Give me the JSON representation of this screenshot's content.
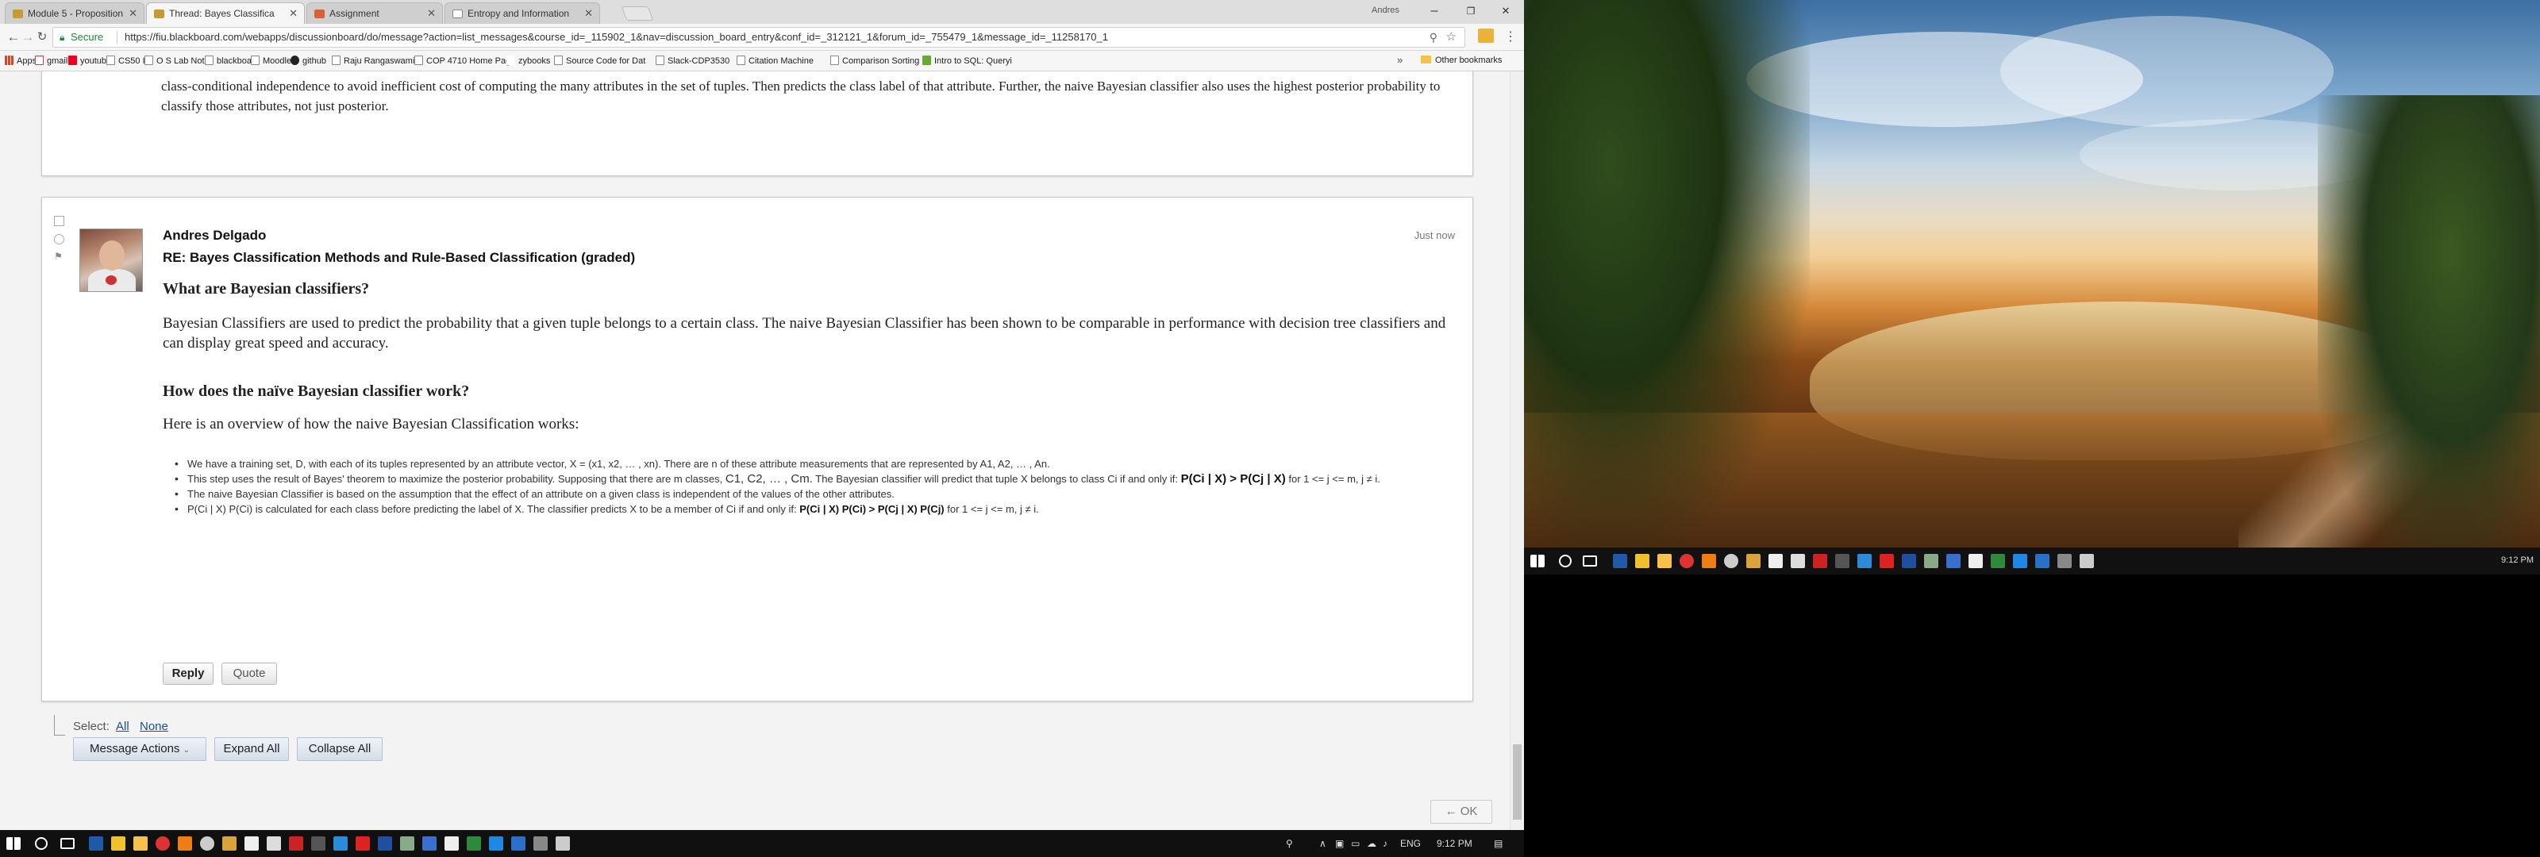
{
  "browser": {
    "profile_name": "Andres",
    "tabs": [
      {
        "label": "Module 5 - Proposition",
        "color": "#c69a3b",
        "active": false
      },
      {
        "label": "Thread: Bayes Classifica",
        "color": "#c69a3b",
        "active": true
      },
      {
        "label": "Assignment",
        "color": "#d9613a",
        "active": false
      },
      {
        "label": "Entropy and Information",
        "color": "#888888",
        "active": false
      }
    ],
    "window_controls": {
      "minimize": "–",
      "maximize": "❐",
      "close": "✕"
    },
    "secure_label": "Secure",
    "url": "https://fiu.blackboard.com/webapps/discussionboard/do/message?action=list_messages&course_id=_115902_1&nav=discussion_board_entry&conf_id=_312121_1&forum_id=_755479_1&message_id=_11258170_1",
    "bookmarks": [
      "Apps",
      "gmail",
      "youtube",
      "CS50 ID",
      "O S Lab Notes",
      "blackboard",
      "Moodle",
      "github",
      "Raju Rangaswami",
      "COP 4710 Home Pag",
      "zybooks",
      "Source Code for Dat",
      "Slack-CDP3530",
      "Citation Machine",
      "Comparison Sorting",
      "Intro to SQL: Queryi"
    ],
    "bookmarks_more": "»",
    "other_bookmarks": "Other bookmarks"
  },
  "previous_post": {
    "text": "class-conditional independence to avoid inefficient cost of computing the many attributes in the set of tuples. Then predicts the class label of that attribute. Further, the naive Bayesian classifier also uses the highest posterior probability to classify those attributes, not just posterior."
  },
  "post": {
    "author": "Andres Delgado",
    "timestamp": "Just now",
    "subject": "RE: Bayes Classification Methods and Rule-Based Classification (graded)",
    "heading1": "What are Bayesian classifiers?",
    "para1": "Bayesian Classifiers are used to predict the probability that a given tuple belongs to a certain class. The naive Bayesian Classifier has been shown to be comparable in performance with decision tree classifiers and can display great speed and accuracy.",
    "heading2": "How does the naïve Bayesian classifier work?",
    "para2": "Here is an overview of how the naive Bayesian Classification works:",
    "bullet1": "We have a training set, D, with each of its tuples represented by an attribute vector, X = (x1, x2, … , xn). There are n of these attribute measurements that are represented by A1, A2, … , An.",
    "bullet2a": "This step uses the result of Bayes' theorem to maximize the posterior probability. Supposing that there are m classes,",
    "bullet2b": "C1, C2, … , Cm.",
    "bullet2c": "The Bayesian classifier will predict that tuple X belongs to class Ci if and only if:",
    "bullet2d": "P(Ci | X) > P(Cj | X)",
    "bullet2e": "for 1 <= j <= m, j ≠ i.",
    "bullet3": "The naive Bayesian Classifier is based on the assumption that the effect of an attribute on a given class is independent of the values of the other attributes.",
    "bullet4a": "P(Ci | X) P(Ci) is calculated for each class before predicting the label of X. The classifier predicts X to be a member of Ci if and only if:",
    "bullet4b": "P(Ci | X) P(Ci) > P(Cj | X) P(Cj)",
    "bullet4c": "for 1 <= j <= m, j ≠ i.",
    "reply_label": "Reply",
    "quote_label": "Quote"
  },
  "selection": {
    "label": "Select:",
    "all": "All",
    "none": "None",
    "message_actions": "Message Actions",
    "expand_all": "Expand All",
    "collapse_all": "Collapse All",
    "ok": "← OK"
  },
  "taskbar_left": {
    "language": "ENG",
    "time": "9:12 PM"
  },
  "taskbar_right": {
    "time": "9:12 PM"
  }
}
